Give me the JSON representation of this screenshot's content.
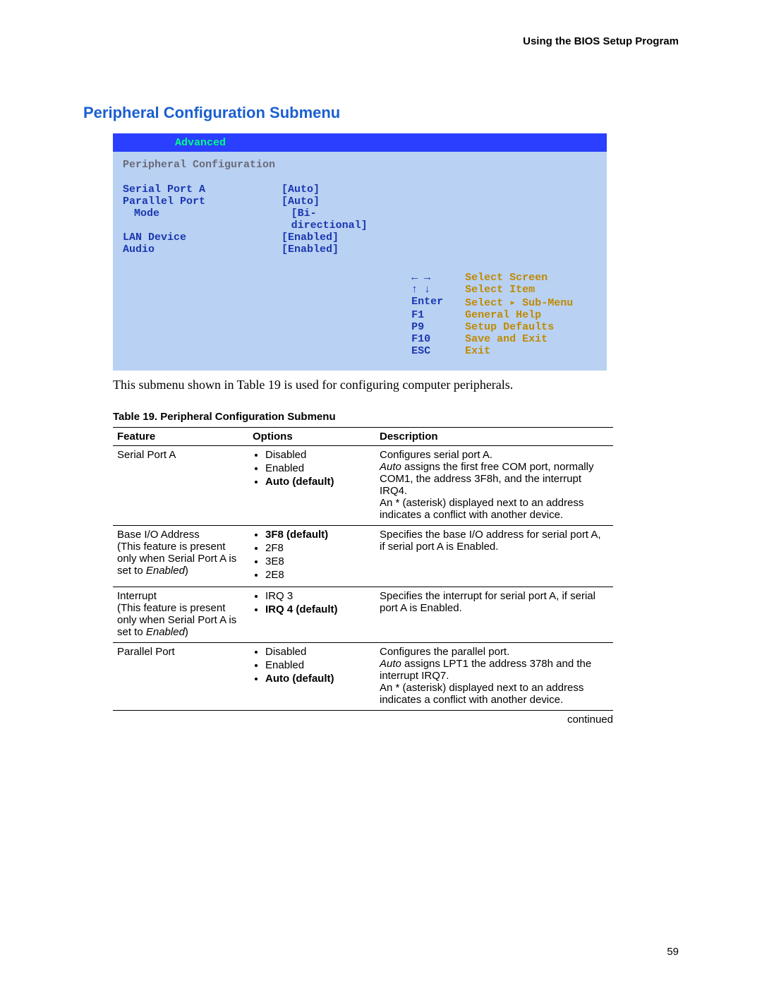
{
  "header": {
    "running": "Using the BIOS Setup Program"
  },
  "section_title": "Peripheral Configuration Submenu",
  "bios": {
    "tab": "Advanced",
    "subtitle": "Peripheral Configuration",
    "items": [
      {
        "label": "Serial Port A",
        "value": "[Auto]"
      },
      {
        "label": "Parallel Port",
        "value": "[Auto]"
      },
      {
        "label": "Mode",
        "value": "[Bi-directional]",
        "indent": true
      },
      {
        "label": "LAN Device",
        "value": "[Enabled]"
      },
      {
        "label": "Audio",
        "value": "[Enabled]"
      }
    ],
    "help": [
      {
        "key": "←  →",
        "text": "Select Screen"
      },
      {
        "key": "↑  ↓",
        "text": "Select Item"
      },
      {
        "key": "Enter",
        "text": "Select ▸ Sub-Menu"
      },
      {
        "key": "F1",
        "text": "General Help"
      },
      {
        "key": "P9",
        "text": "Setup Defaults"
      },
      {
        "key": "F10",
        "text": "Save and Exit"
      },
      {
        "key": "ESC",
        "text": "Exit"
      }
    ]
  },
  "caption": "This submenu shown in Table 19 is used for configuring computer peripherals.",
  "table_title": "Table 19.    Peripheral Configuration Submenu",
  "columns": {
    "feature": "Feature",
    "options": "Options",
    "description": "Description"
  },
  "rows": {
    "r0": {
      "feature_plain": "Serial Port A",
      "opts": [
        "Disabled",
        "Enabled",
        "Auto (default)"
      ],
      "opt_bold": [
        false,
        false,
        true
      ],
      "desc_l1": "Configures serial port A.",
      "desc_l2a": "Auto",
      "desc_l2b": " assigns the first free COM port, normally COM1, the address 3F8h, and the interrupt IRQ4.",
      "desc_l3": "An * (asterisk) displayed next to an address indicates a conflict with another device."
    },
    "r1": {
      "feature_l1": "Base I/O Address",
      "feature_l2": "(This feature is present only when Serial Port A is set to ",
      "feature_l2_ital": "Enabled",
      "feature_l2_tail": ")",
      "opts": [
        "3F8 (default)",
        "2F8",
        "3E8",
        "2E8"
      ],
      "opt_bold": [
        true,
        false,
        false,
        false
      ],
      "desc": "Specifies the base I/O address for serial port A, if serial port A is Enabled."
    },
    "r2": {
      "feature_l1": "Interrupt",
      "feature_l2": "(This feature is present only when Serial Port A is set to ",
      "feature_l2_ital": "Enabled",
      "feature_l2_tail": ")",
      "opts": [
        "IRQ 3",
        "IRQ 4 (default)"
      ],
      "opt_bold": [
        false,
        true
      ],
      "desc": "Specifies the interrupt for serial port A, if serial port A is Enabled."
    },
    "r3": {
      "feature_plain": "Parallel Port",
      "opts": [
        "Disabled",
        "Enabled",
        "Auto (default)"
      ],
      "opt_bold": [
        false,
        false,
        true
      ],
      "desc_l1": "Configures the parallel port.",
      "desc_l2a": "Auto",
      "desc_l2b": " assigns LPT1 the address 378h and the interrupt IRQ7.",
      "desc_l3": "An * (asterisk) displayed next to an address indicates a conflict with another device."
    }
  },
  "continued": "continued",
  "page_number": "59"
}
